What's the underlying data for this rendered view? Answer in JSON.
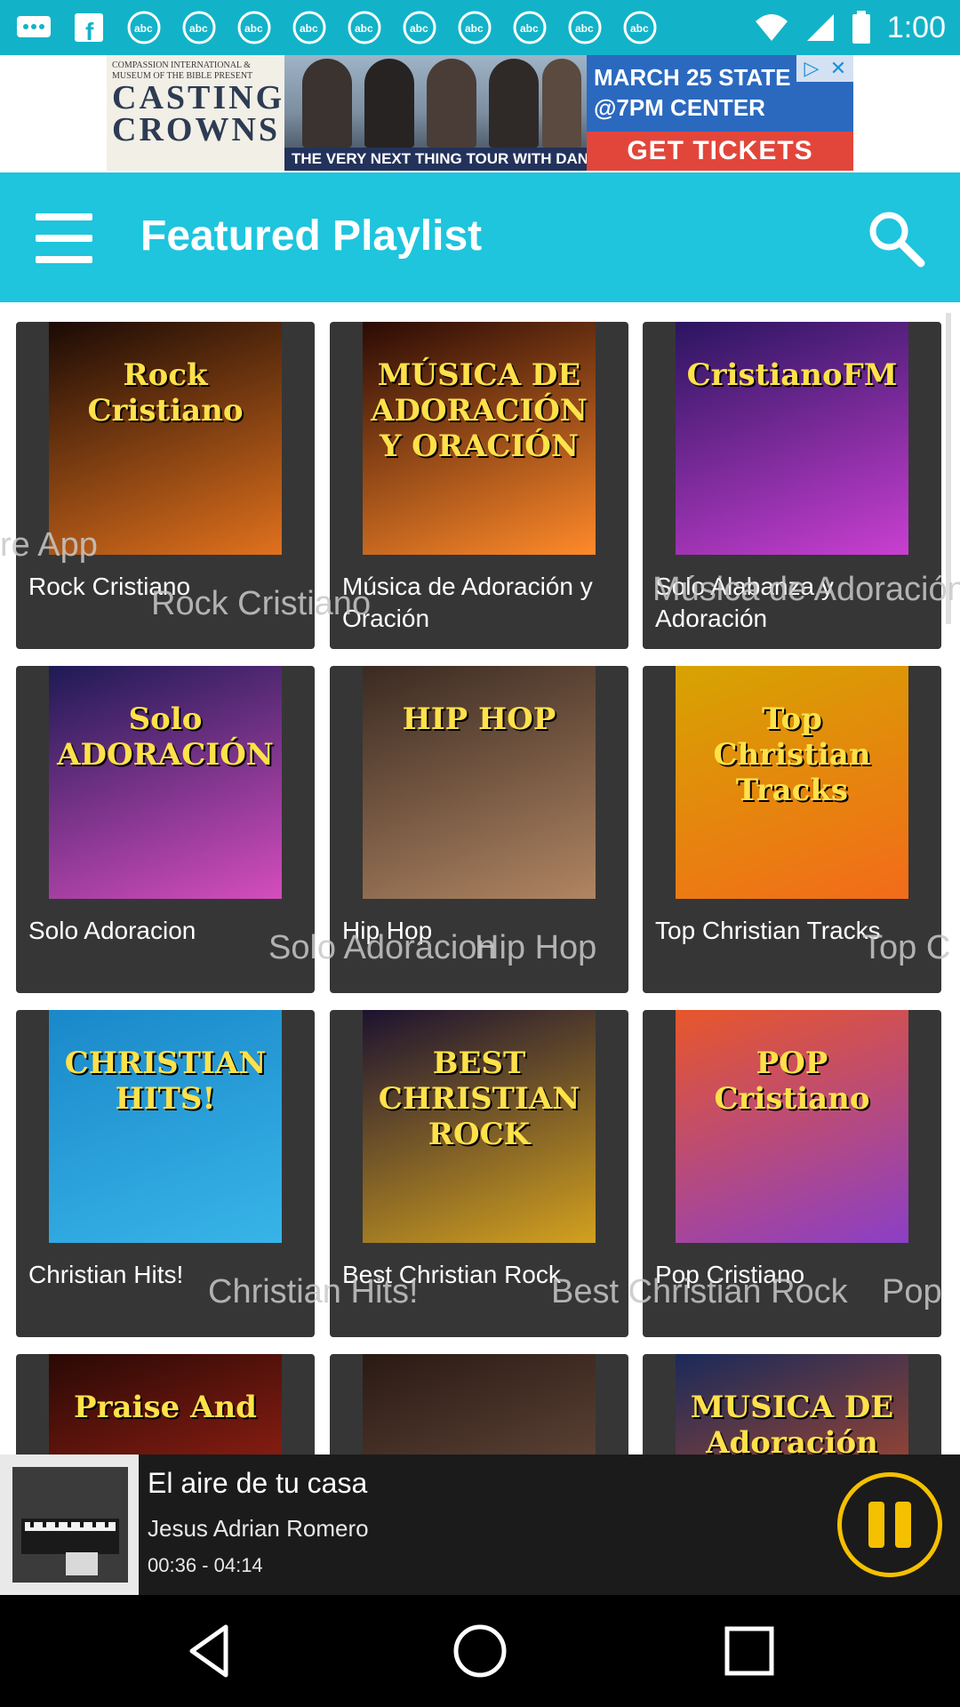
{
  "status_bar": {
    "time": "1:00",
    "left_icons": [
      "message-icon",
      "facebook-icon",
      "abc-icon",
      "abc-icon",
      "abc-icon",
      "abc-icon",
      "abc-icon",
      "abc-icon",
      "abc-icon",
      "abc-icon",
      "abc-icon",
      "abc-icon"
    ],
    "right_icons": [
      "wifi-icon",
      "signal-icon",
      "battery-icon"
    ]
  },
  "ad": {
    "left_small_text": "COMPASSION INTERNATIONAL & MUSEUM OF THE BIBLE PRESENT",
    "headline": "CASTING CROWNS",
    "caption": "THE VERY NEXT THING TOUR WITH DANNY GOKEY & UNSPOKEN",
    "date": "MARCH 25 STATE",
    "time_venue": "@7PM  CENTER",
    "cta": "GET TICKETS"
  },
  "app_bar": {
    "title": "Featured Playlist"
  },
  "playlists": [
    {
      "title": "Rock Cristiano",
      "art_text": "Rock Cristiano",
      "colors": [
        "#1a0a05",
        "#e0711d"
      ]
    },
    {
      "title": "Música de Adoración y Oración",
      "art_text": "MÚSICA DE ADORACIÓN Y ORACIÓN",
      "colors": [
        "#2a0a05",
        "#ff8a2a"
      ]
    },
    {
      "title": "Solo Alabanza y Adoración",
      "art_text": "CristianoFM",
      "colors": [
        "#2a1560",
        "#c93fd1"
      ]
    },
    {
      "title": "Solo Adoracion",
      "art_text": "Solo ADORACIÓN",
      "colors": [
        "#1e1a55",
        "#d54dbd"
      ]
    },
    {
      "title": "Hip Hop",
      "art_text": "HIP HOP",
      "colors": [
        "#3a2a22",
        "#b08562"
      ]
    },
    {
      "title": "Top Christian Tracks",
      "art_text": "Top Christian Tracks",
      "colors": [
        "#d6a400",
        "#f36b1a"
      ]
    },
    {
      "title": "Christian Hits!",
      "art_text": "CHRISTIAN HITS!",
      "colors": [
        "#1a88c9",
        "#38b4e8"
      ]
    },
    {
      "title": "Best Christian Rock",
      "art_text": "BEST CHRISTIAN ROCK",
      "colors": [
        "#1c1230",
        "#d3a11f"
      ]
    },
    {
      "title": "Pop Cristiano",
      "art_text": "POP Cristiano",
      "colors": [
        "#e8572a",
        "#8b3fc7"
      ]
    },
    {
      "title": "",
      "art_text": "Praise And",
      "colors": [
        "#2a0905",
        "#c42a1a"
      ]
    },
    {
      "title": "",
      "art_text": "",
      "colors": [
        "#2a1a14",
        "#7a5a4a"
      ]
    },
    {
      "title": "",
      "art_text": "MUSICA DE Adoración",
      "colors": [
        "#1a2a5a",
        "#e0541c"
      ]
    }
  ],
  "ghost_texts": {
    "g1": "re App",
    "g2": "Rock Cristiano",
    "g3": "Música de Adoración",
    "g4": "Solo Adoracion",
    "g5": "Hip Hop",
    "g6": "Top C",
    "g7": "Christian Hits!",
    "g8": "Best Christian Rock",
    "g9": "Pop"
  },
  "player": {
    "song": "El aire de tu casa",
    "artist": "Jesus Adrian Romero",
    "time": "00:36 - 04:14"
  },
  "nav": [
    "back-icon",
    "home-icon",
    "recents-icon"
  ]
}
